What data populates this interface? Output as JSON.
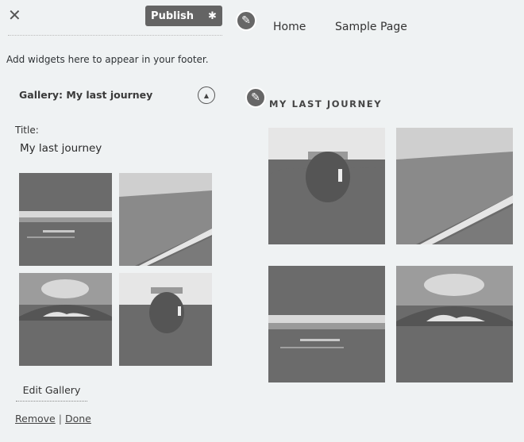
{
  "toolbar": {
    "close_icon": "close-icon",
    "publish_label": "Publish",
    "settings_icon": "gear-icon"
  },
  "panel": {
    "footer_description": "Add widgets here to appear in your footer.",
    "widget": {
      "header": "Gallery: My last journey",
      "title_label": "Title:",
      "title_value": "My last journey",
      "edit_gallery_label": "Edit Gallery",
      "remove_label": "Remove",
      "separator": "|",
      "done_label": "Done"
    }
  },
  "preview": {
    "nav": [
      "Home",
      "Sample Page"
    ],
    "widget_title": "MY LAST JOURNEY",
    "edit_icon": "pencil-icon"
  },
  "gallery": {
    "images": [
      "beach",
      "cliffs",
      "rock-arch",
      "jar"
    ],
    "preview_images": [
      "jar",
      "cliffs",
      "beach",
      "rock-arch"
    ]
  },
  "colors": {
    "background": "#eff2f3",
    "button": "#646464",
    "image_fill": "#6b6b6b"
  }
}
